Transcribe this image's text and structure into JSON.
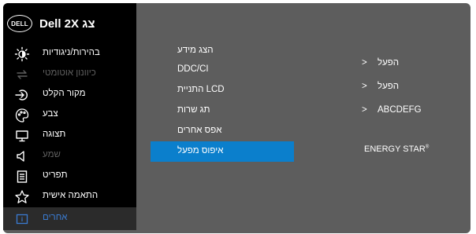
{
  "header": {
    "logo_text": "DELL",
    "model_title": "Dell 2X צג"
  },
  "sidebar": {
    "items": [
      {
        "label": "בהירות/ניגודיות",
        "icon": "brightness-icon",
        "state": "normal"
      },
      {
        "label": "כיוונון אוטומטי",
        "icon": "auto-adjust-icon",
        "state": "disabled"
      },
      {
        "label": "מקור הקלט",
        "icon": "input-source-icon",
        "state": "normal"
      },
      {
        "label": "צבע",
        "icon": "color-icon",
        "state": "normal"
      },
      {
        "label": "תצוגה",
        "icon": "display-icon",
        "state": "normal"
      },
      {
        "label": "שמע",
        "icon": "audio-icon",
        "state": "disabled"
      },
      {
        "label": "תפריט",
        "icon": "menu-icon",
        "state": "normal"
      },
      {
        "label": "התאמה אישית",
        "icon": "star-icon",
        "state": "normal"
      },
      {
        "label": "אחרים",
        "icon": "others-icon",
        "state": "active"
      }
    ]
  },
  "submenu": {
    "items": [
      {
        "label": "הצג מידע"
      },
      {
        "label": "DDC/CI"
      },
      {
        "label": "התניית LCD"
      },
      {
        "label": "תג שרות"
      },
      {
        "label": "אפס אחרים"
      },
      {
        "label": "איפוס מפעל",
        "selected": true
      }
    ]
  },
  "values": {
    "ddc_ci": "הפעל",
    "lcd_conditioning": "הפעל",
    "service_tag": "ABCDEFG",
    "chevron": ">",
    "energy_star": "ENERGY STAR",
    "energy_star_mark": "®"
  },
  "colors": {
    "panel_bg": "#5d5d5d",
    "sidebar_bg": "#000000",
    "selected_bg": "#0b7fcc",
    "active_label": "#3a7bd1",
    "disabled_label": "#5f5f5f"
  }
}
